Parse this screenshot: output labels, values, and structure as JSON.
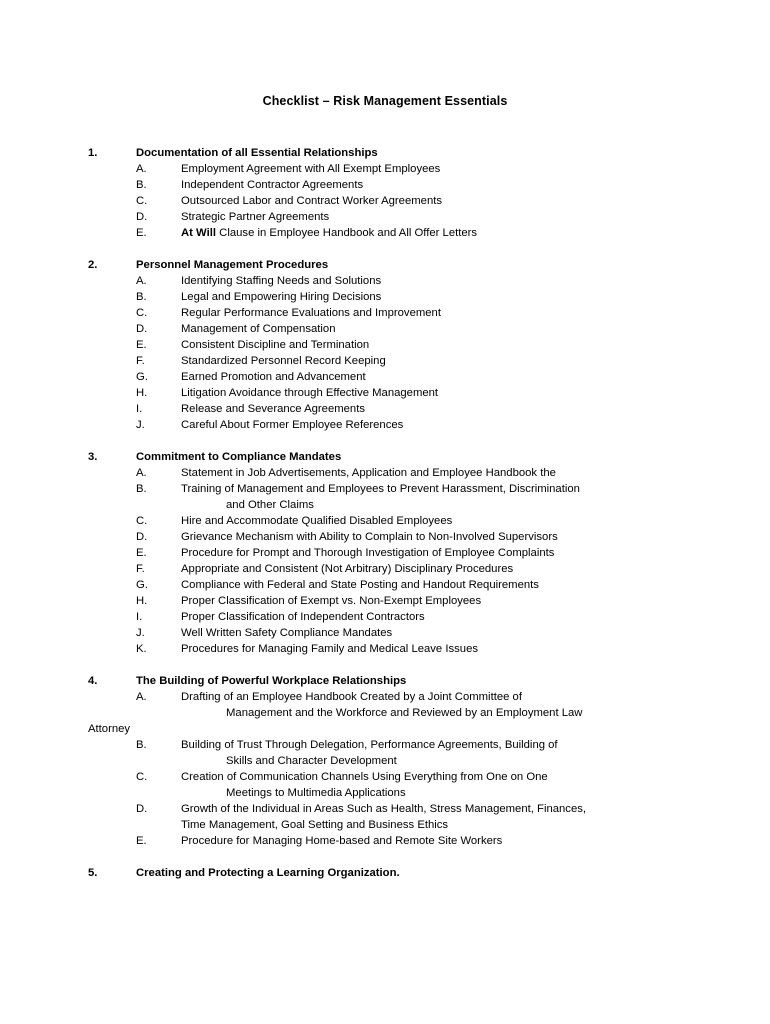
{
  "document": {
    "title": "Checklist – Risk Management Essentials"
  },
  "sections": [
    {
      "number": "1.",
      "heading": "Documentation of all Essential Relationships",
      "items": [
        {
          "letter": "A.",
          "text": "Employment Agreement with All Exempt Employees"
        },
        {
          "letter": "B.",
          "text": "Independent Contractor Agreements"
        },
        {
          "letter": "C.",
          "text": "Outsourced Labor and Contract Worker Agreements"
        },
        {
          "letter": "D.",
          "text": "Strategic Partner Agreements"
        },
        {
          "letter": "E.",
          "bold_prefix": "At Will",
          "text": " Clause in Employee Handbook and All Offer Letters"
        }
      ]
    },
    {
      "number": "2.",
      "heading": "Personnel Management Procedures",
      "items": [
        {
          "letter": "A.",
          "text": "Identifying Staffing Needs and Solutions"
        },
        {
          "letter": "B.",
          "text": "Legal and Empowering Hiring Decisions"
        },
        {
          "letter": "C.",
          "text": "Regular Performance Evaluations and Improvement"
        },
        {
          "letter": "D.",
          "text": "Management of Compensation"
        },
        {
          "letter": "E.",
          "text": "Consistent Discipline and Termination"
        },
        {
          "letter": "F.",
          "text": "Standardized Personnel Record Keeping"
        },
        {
          "letter": "G.",
          "text": "Earned Promotion and Advancement"
        },
        {
          "letter": "H.",
          "text": "Litigation Avoidance through Effective Management"
        },
        {
          "letter": "I.",
          "text": "Release and Severance Agreements"
        },
        {
          "letter": "J.",
          "text": "Careful About Former Employee References"
        }
      ]
    },
    {
      "number": "3.",
      "heading": "Commitment to Compliance Mandates",
      "items": [
        {
          "letter": "A.",
          "text": "Statement in Job Advertisements, Application and Employee Handbook the"
        },
        {
          "letter": "B.",
          "text": "Training of Management and Employees to Prevent Harassment, Discrimination",
          "continuation": "and Other Claims"
        },
        {
          "letter": "C.",
          "text": "Hire and Accommodate Qualified Disabled Employees"
        },
        {
          "letter": "D.",
          "text": "Grievance Mechanism with Ability to Complain to Non-Involved Supervisors"
        },
        {
          "letter": "E.",
          "text": "Procedure for Prompt and Thorough Investigation of Employee Complaints"
        },
        {
          "letter": "F.",
          "text": "Appropriate and Consistent (Not Arbitrary) Disciplinary Procedures"
        },
        {
          "letter": "G.",
          "text": "Compliance with Federal and State Posting and Handout Requirements"
        },
        {
          "letter": "H.",
          "text": "Proper Classification of Exempt vs. Non-Exempt Employees"
        },
        {
          "letter": "I.",
          "text": "Proper Classification of Independent Contractors"
        },
        {
          "letter": "J.",
          "text": "Well Written Safety Compliance Mandates"
        },
        {
          "letter": "K.",
          "text": "Procedures for Managing Family and Medical Leave Issues"
        }
      ]
    },
    {
      "number": "4.",
      "heading": "The Building of Powerful Workplace Relationships",
      "items": [
        {
          "letter": "A.",
          "text": "Drafting of an Employee Handbook Created by a Joint Committee of",
          "continuation": "Management and the Workforce and Reviewed by an Employment Law",
          "margin_continuation": "Attorney"
        },
        {
          "letter": "B.",
          "text": "Building of Trust Through Delegation, Performance Agreements, Building of",
          "continuation": "Skills and Character Development"
        },
        {
          "letter": "C.",
          "text": "Creation of Communication Channels Using Everything from One on One",
          "continuation": "Meetings to Multimedia Applications"
        },
        {
          "letter": "D.",
          "text": "Growth of the Individual in Areas Such as Health, Stress Management, Finances,",
          "flush_continuation": "Time Management, Goal Setting and Business Ethics"
        },
        {
          "letter": "E.",
          "text": "Procedure for Managing Home-based and Remote Site Workers"
        }
      ]
    },
    {
      "number": "5.",
      "heading": "Creating and Protecting a Learning Organization.",
      "items": []
    }
  ]
}
